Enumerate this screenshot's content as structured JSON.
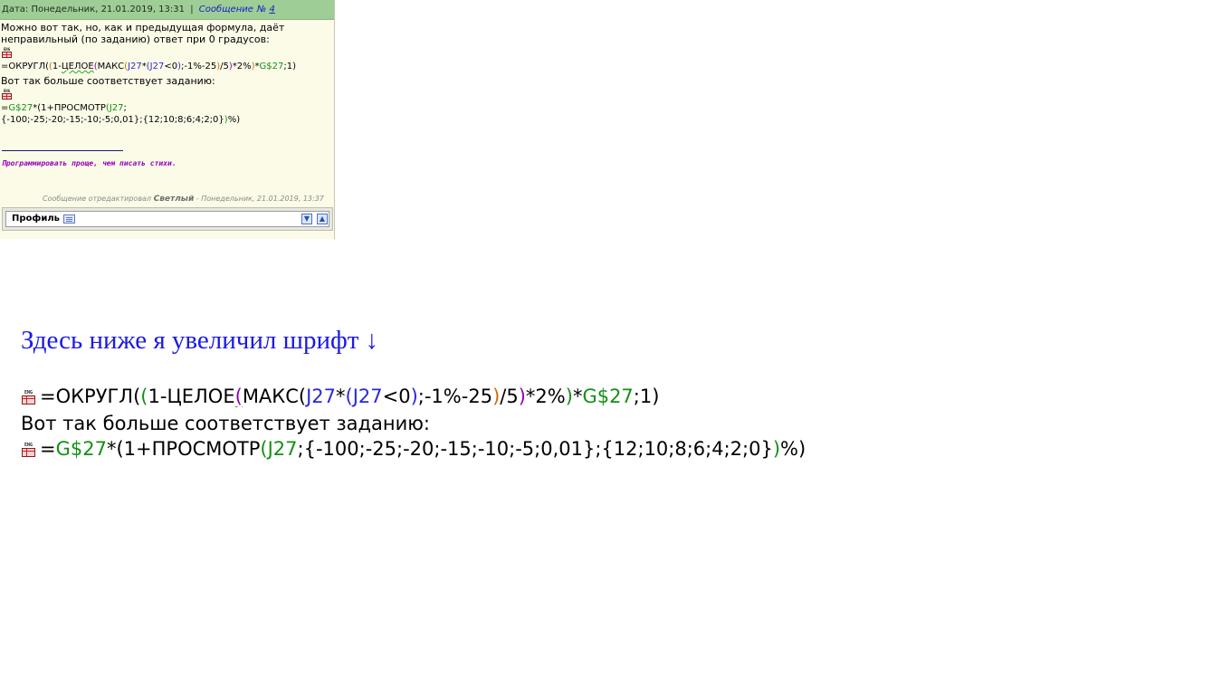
{
  "post": {
    "header": {
      "date_label": "Дата:",
      "date_value": "Понедельник, 21.01.2019, 13:31",
      "separator": "|",
      "message_label": "Сообщение",
      "no_sign": "№",
      "message_number": "4"
    },
    "paragraph1": "Можно вот так, но, как и предыдущая формула, даёт неправильный (по заданию) ответ при 0 градусов:",
    "eng_icon_label": "ENG",
    "formula1_small": {
      "p1": "=ОКРУГЛ(",
      "p2": "(",
      "p3": "1-",
      "p4": "ЦЕЛОЕ",
      "p5": "(",
      "p6": "МАКС",
      "p7": "(",
      "p8": "J27",
      "p9": "*",
      "p10": "(",
      "p11": "J27",
      "p12": "<0",
      "p13": ")",
      "p14": ";-1%-25",
      "p15": ")",
      "p16": "/5",
      "p17": ")",
      "p18": "*2%",
      "p19": ")",
      "p20": "*",
      "p21": "G$27",
      "p22": ";1)"
    },
    "paragraph2": "Вот так больше соответствует заданию:",
    "formula2_small": {
      "p1": "=",
      "p2": "G$27",
      "p3": "*(1+ПРОСМОТР",
      "p4": "(",
      "p5": "J27",
      "p6": ";{-100;-25;-20;-15;-10;-5;0,01};{12;10;8;6;4;2;0}",
      "p7": ")",
      "p8": "%)"
    },
    "signature": "Программировать проще, чем писать стихи.",
    "edited": {
      "prefix": "Сообщение отредактировал",
      "editor": "Светлый",
      "suffix": "- Понедельник, 21.01.2019, 13:37"
    },
    "footer": {
      "profile_label": "Профиль"
    }
  },
  "enlarged": {
    "heading": "Здесь ниже  я увеличил шрифт ↓",
    "formula1": {
      "p1": "=ОКРУГЛ(",
      "p2": "(",
      "p3": "1-ЦЕЛОЕ",
      "p4": "(",
      "p5": "МАКС(",
      "p6": "J27",
      "p7": "*",
      "p8": "(",
      "p9": "J27",
      "p10": "<0",
      "p11": ")",
      "p12": ";-1%-25",
      "p13": ")",
      "p14": "/5",
      "p15": ")",
      "p16": "*2%",
      "p17": ")",
      "p18": "*",
      "p19": "G$27",
      "p20": ";1)"
    },
    "text_line": "Вот так больше соответствует заданию:",
    "formula2": {
      "p1": "=",
      "p2": "G$27",
      "p3": "*(1+ПРОСМОТР",
      "p4": "(",
      "p5": "J27",
      "p6": ";{-100;-25;-20;-15;-10;-5;0,01};{12;10;8;6;4;2;0}",
      "p7": ")",
      "p8": "%)"
    }
  },
  "colors": {
    "header_bg": "#9ece95",
    "post_bg": "#fbfbe8",
    "heading_blue": "#1a1ae6",
    "ref_blue": "#2a2ad4",
    "ref_green": "#149014",
    "paren_orange": "#d46a00",
    "signature_purple": "#9400b8"
  },
  "icons": [
    "eng-spreadsheet-icon",
    "profile-card-icon",
    "arrow-down-icon",
    "arrow-up-icon"
  ]
}
